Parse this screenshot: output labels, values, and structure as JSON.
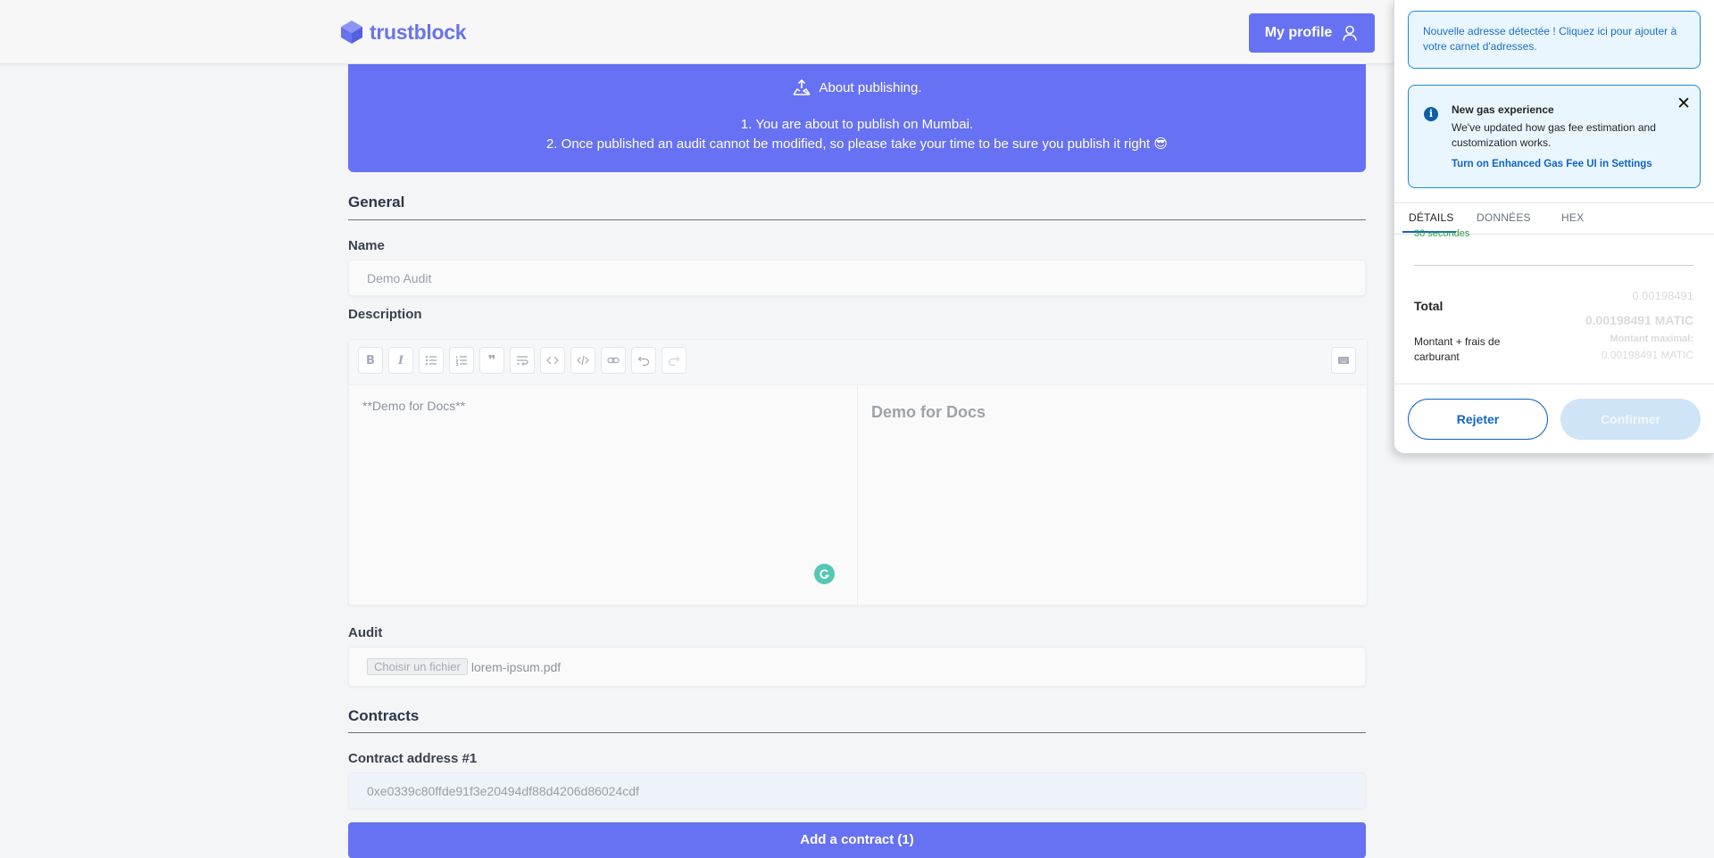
{
  "header": {
    "logo_text": "trustblock",
    "profile_label": "My profile"
  },
  "banner": {
    "title": "About publishing.",
    "line1": "1. You are about to publish on Mumbai.",
    "line2": "2. Once published an audit cannot be modified, so please take your time to be sure you publish it right 😎"
  },
  "form": {
    "general_title": "General",
    "name_label": "Name",
    "name_value": "Demo Audit",
    "description_label": "Description",
    "description_source": "**Demo for Docs**",
    "description_preview": "Demo for Docs",
    "audit_label": "Audit",
    "file_button": "Choisir un fichier",
    "file_name": "lorem-ipsum.pdf",
    "contracts_title": "Contracts",
    "contract_label": "Contract address #1",
    "contract_value": "0xe0339c80ffde91f3e20494df88d4206d86024cdf",
    "add_contract_label": "Add a contract (1)"
  },
  "toolbar": {
    "tools": [
      "bold",
      "italic",
      "unordered-list",
      "ordered-list",
      "quote",
      "wrap",
      "code",
      "code-block",
      "link",
      "undo",
      "redo"
    ]
  },
  "wallet": {
    "new_address_notice": "Nouvelle adresse détectée ! Cliquez ici pour ajouter à votre carnet d'adresses.",
    "gas_title": "New gas experience",
    "gas_body": "We've updated how gas fee estimation and customization works.",
    "gas_link": "Turn on Enhanced Gas Fee UI in Settings",
    "tabs": [
      "DÉTAILS",
      "DONNÉES",
      "HEX"
    ],
    "active_tab": "DÉTAILS",
    "time_estimate": "30 secondes",
    "total_label": "Total",
    "total_small": "0.00198491",
    "total_big": "0.00198491 MATIC",
    "amount_fees_label": "Montant + frais de carburant",
    "max_label": "Montant maximal:",
    "max_value": "0.00198491 MATIC",
    "reject_label": "Rejeter",
    "confirm_label": "Confirmer",
    "colors": {
      "accent": "#0f65c6",
      "success": "#2a9e44"
    }
  },
  "colors": {
    "brand": "#6672f1"
  }
}
